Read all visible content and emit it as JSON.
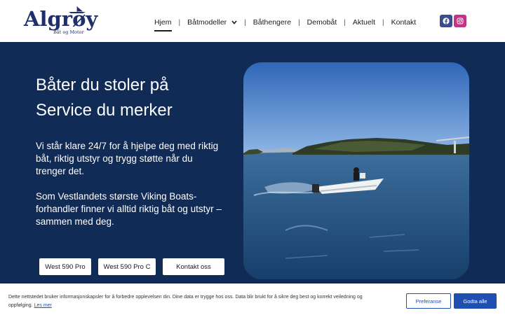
{
  "brand": {
    "name": "Algrøy",
    "tagline": "Båt og Motor"
  },
  "nav": {
    "items": [
      {
        "label": "Hjem",
        "active": true
      },
      {
        "label": "Båtmodeller",
        "has_dropdown": true
      },
      {
        "label": "Båthengere"
      },
      {
        "label": "Demobåt"
      },
      {
        "label": "Aktuelt"
      },
      {
        "label": "Kontakt"
      }
    ],
    "separator": "|"
  },
  "social": {
    "facebook_icon": "facebook-icon",
    "instagram_icon": "instagram-icon",
    "facebook_color": "#3b4d8f",
    "instagram_color": "#c13584"
  },
  "hero": {
    "headline_line1": "Båter du stoler på",
    "headline_line2": "Service du merker",
    "paragraph1": "Vi står klare 24/7 for å hjelpe deg med riktig båt, riktig utstyr og trygg støtte når du trenger det.",
    "paragraph2": "Som Vestlandets største Viking Boats-forhandler finner vi alltid riktig båt og utstyr – sammen med deg.",
    "buttons": [
      "West 590 Pro",
      "West 590 Pro C",
      "Kontakt oss"
    ],
    "background_color": "#102b56"
  },
  "cookie": {
    "text": "Dette nettstedet bruker informasjonskapsler for å forbedre opplevelsen din. Dine data er trygge hos oss. Data blir brukt for å sikre deg best og korrekt veiledning og oppfølging.",
    "link_label": "Les mer",
    "preferences_label": "Preferanse",
    "accept_label": "Godta alle",
    "accent_color": "#1f4fb0"
  }
}
